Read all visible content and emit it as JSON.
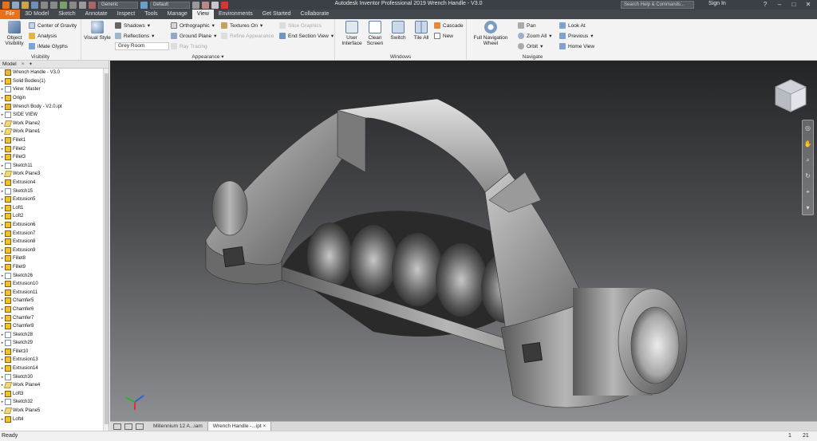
{
  "titlebar": {
    "title": "Autodesk Inventor Professional 2019    Wrench Handle - V3.0",
    "material": "Generic",
    "appearance": "Default",
    "search_placeholder": "Search Help & Commands...",
    "sign_in": "Sign In"
  },
  "tabs": [
    "File",
    "3D Model",
    "Sketch",
    "Annotate",
    "Inspect",
    "Tools",
    "Manage",
    "View",
    "Environments",
    "Get Started",
    "Collaborate"
  ],
  "ribbon": {
    "visibility": {
      "object_visibility": "Object\nVisibility",
      "center_of_gravity": "Center of Gravity",
      "analysis": "Analysis",
      "imate_glyphs": "iMate Glyphs",
      "title": "Visibility"
    },
    "appearance": {
      "visual_style": "Visual Style",
      "shadows": "Shadows",
      "reflections": "Reflections",
      "lighting": "Grey Room",
      "orthographic": "Orthographic",
      "ground_plane": "Ground Plane",
      "ray_tracing": "Ray Tracing",
      "textures_on": "Textures On",
      "refine_appearance": "Refine Appearance",
      "slice_graphics": "Slice Graphics",
      "end_section_view": "End Section View",
      "title": "Appearance"
    },
    "windows": {
      "user_interface": "User\nInterface",
      "clean_screen": "Clean\nScreen",
      "switch": "Switch",
      "tile_all": "Tile All",
      "cascade": "Cascade",
      "new": "New",
      "title": "Windows"
    },
    "navigate": {
      "full_navigation_wheel": "Full Navigation\nWheel",
      "pan": "Pan",
      "zoom_all": "Zoom All",
      "orbit": "Orbit",
      "look_at": "Look At",
      "previous": "Previous",
      "home_view": "Home View",
      "title": "Navigate"
    }
  },
  "browser": {
    "tab": "Model",
    "add": "+",
    "items": [
      {
        "label": "Wrench Handle - V3.0",
        "icon": "part"
      },
      {
        "label": "Solid Bodies(1)",
        "icon": "feat"
      },
      {
        "label": "View: Master",
        "icon": "sketch"
      },
      {
        "label": "Origin",
        "icon": "feat"
      },
      {
        "label": "Wrench Body - V2.0.ipt",
        "icon": "part"
      },
      {
        "label": "SIDE  VIEW",
        "icon": "sketch"
      },
      {
        "label": "Work Plane2",
        "icon": "plane"
      },
      {
        "label": "Work Plane1",
        "icon": "plane"
      },
      {
        "label": "Fillet1",
        "icon": "feat"
      },
      {
        "label": "Fillet2",
        "icon": "feat"
      },
      {
        "label": "Fillet3",
        "icon": "feat"
      },
      {
        "label": "Sketch11",
        "icon": "sketch"
      },
      {
        "label": "Work Plane3",
        "icon": "plane"
      },
      {
        "label": "Extrusion4",
        "icon": "feat"
      },
      {
        "label": "Sketch15",
        "icon": "sketch"
      },
      {
        "label": "Extrusion5",
        "icon": "feat"
      },
      {
        "label": "Loft1",
        "icon": "feat"
      },
      {
        "label": "Loft2",
        "icon": "feat"
      },
      {
        "label": "Extrusion6",
        "icon": "feat"
      },
      {
        "label": "Extrusion7",
        "icon": "feat"
      },
      {
        "label": "Extrusion8",
        "icon": "feat"
      },
      {
        "label": "Extrusion9",
        "icon": "feat"
      },
      {
        "label": "Fillet8",
        "icon": "feat"
      },
      {
        "label": "Fillet9",
        "icon": "feat"
      },
      {
        "label": "Sketch26",
        "icon": "sketch"
      },
      {
        "label": "Extrusion10",
        "icon": "feat"
      },
      {
        "label": "Extrusion11",
        "icon": "feat"
      },
      {
        "label": "Chamfer5",
        "icon": "feat"
      },
      {
        "label": "Chamfer6",
        "icon": "feat"
      },
      {
        "label": "Chamfer7",
        "icon": "feat"
      },
      {
        "label": "Chamfer8",
        "icon": "feat"
      },
      {
        "label": "Sketch28",
        "icon": "sketch"
      },
      {
        "label": "Sketch29",
        "icon": "sketch"
      },
      {
        "label": "Fillet10",
        "icon": "feat"
      },
      {
        "label": "Extrusion13",
        "icon": "feat"
      },
      {
        "label": "Extrusion14",
        "icon": "feat"
      },
      {
        "label": "Sketch30",
        "icon": "sketch"
      },
      {
        "label": "Work Plane4",
        "icon": "plane"
      },
      {
        "label": "Loft3",
        "icon": "feat"
      },
      {
        "label": "Sketch32",
        "icon": "sketch"
      },
      {
        "label": "Work Plane5",
        "icon": "plane"
      },
      {
        "label": "Loft4",
        "icon": "feat"
      }
    ]
  },
  "doc_tabs": [
    "Millennium 12 A...iam",
    "Wrench Handle -...ipt"
  ],
  "status": {
    "text": "Ready",
    "n1": "1",
    "n2": "21"
  },
  "colors": {
    "file_tab": "#e8711a",
    "titlebar": "#3c4046",
    "model_metal": "#8a8a8a"
  }
}
